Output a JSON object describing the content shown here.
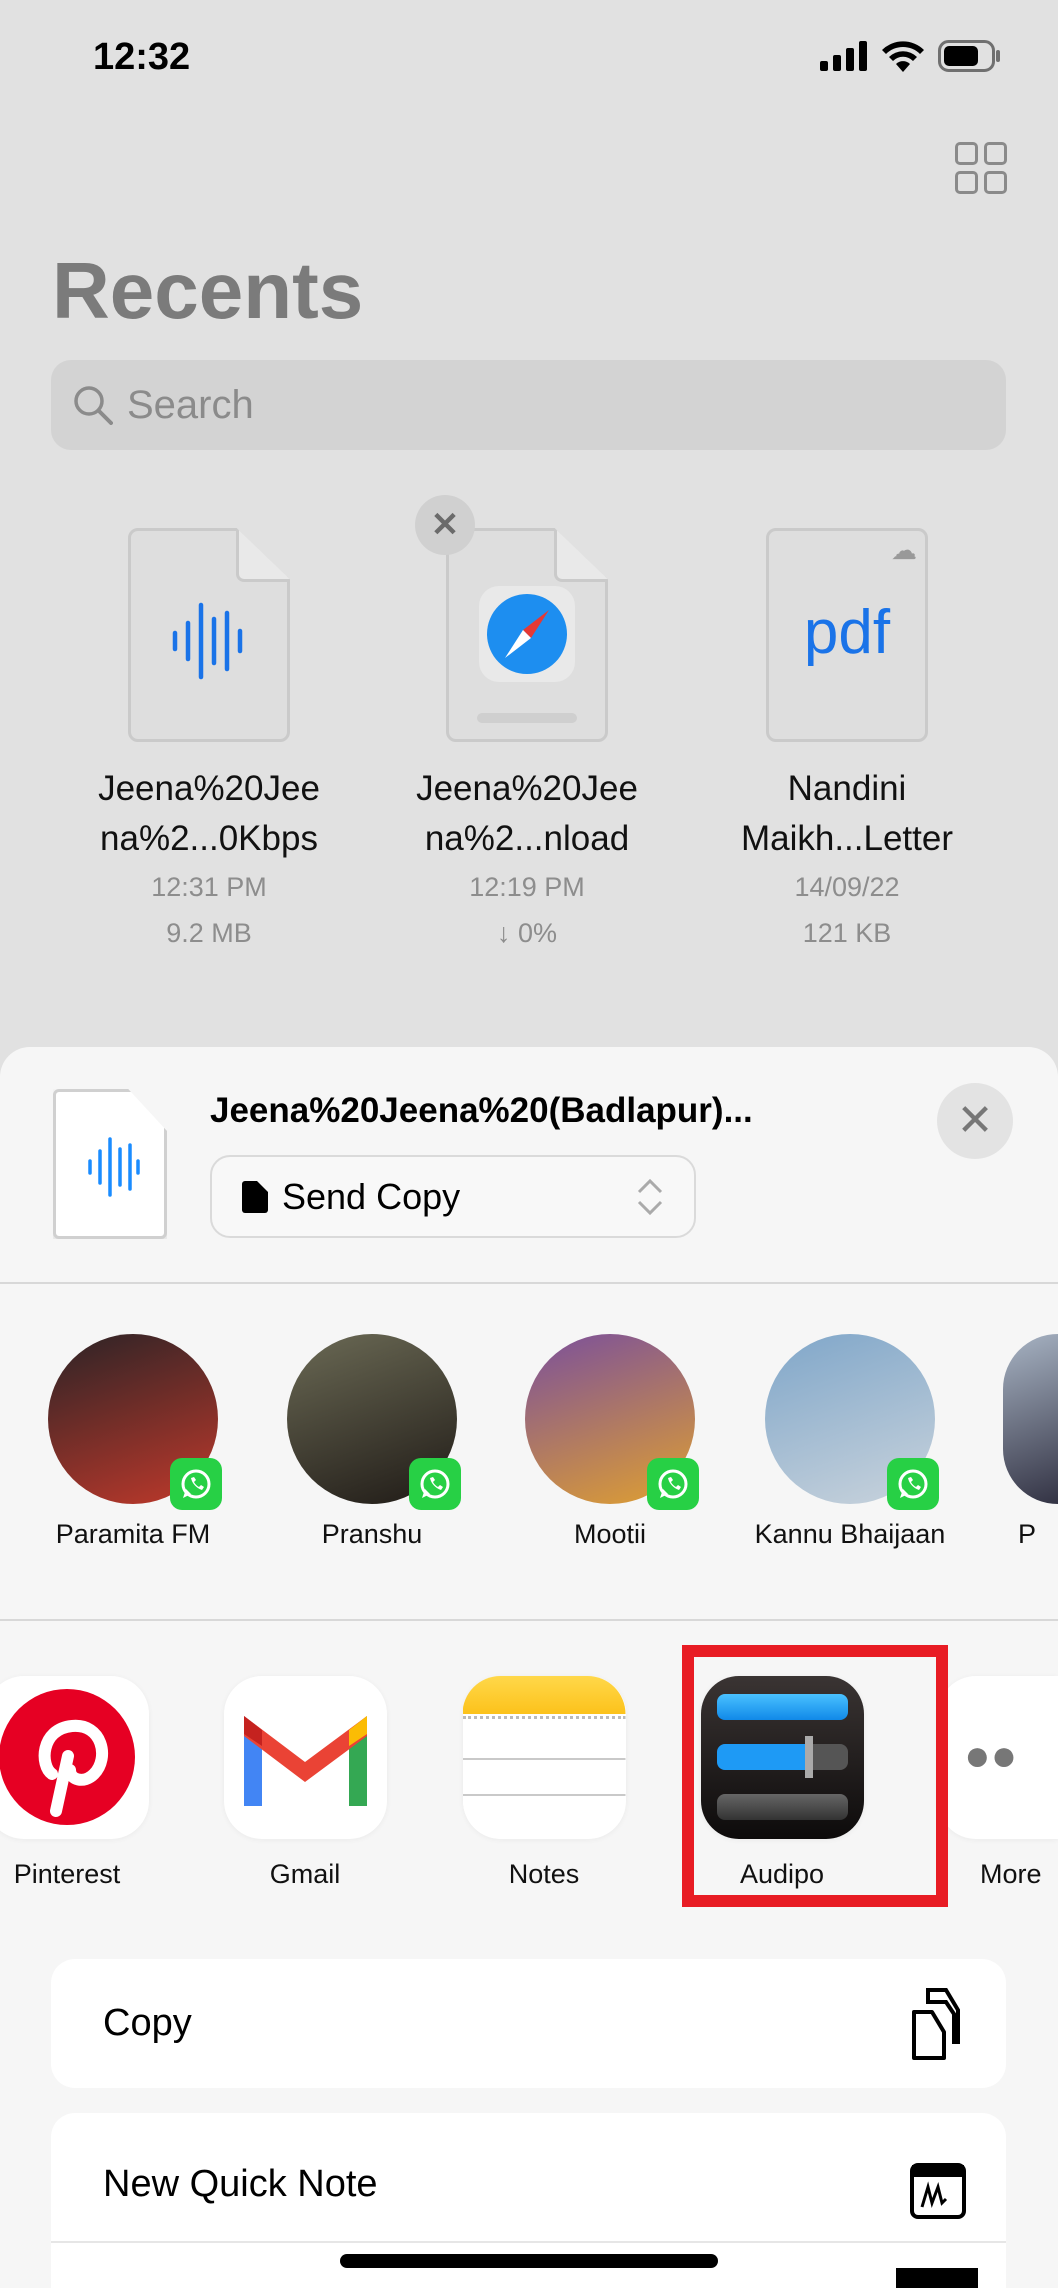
{
  "status_bar": {
    "time": "12:32",
    "icons": [
      "cellular-signal-icon",
      "wifi-icon",
      "battery-icon"
    ]
  },
  "header": {
    "title": "Recents",
    "grid_icon": "grid-view-icon"
  },
  "search": {
    "placeholder": "Search"
  },
  "files": [
    {
      "name1": "Jeena%20Jee",
      "name2": "na%2...0Kbps",
      "meta1": "12:31 PM",
      "meta2": "9.2 MB",
      "icon": "audio-waveform-icon"
    },
    {
      "name1": "Jeena%20Jee",
      "name2": "na%2...nload",
      "meta1": "12:19 PM",
      "meta2": "↓ 0%",
      "icon": "safari-icon"
    },
    {
      "name1": "Nandini",
      "name2": "Maikh...Letter",
      "meta1": "14/09/22",
      "meta2": "121 KB",
      "icon": "pdf-icon",
      "glyph": "pdf"
    }
  ],
  "share": {
    "title": "Jeena%20Jeena%20(Badlapur)...",
    "mode": "Send Copy",
    "people": [
      {
        "name": "Paramita FM",
        "colors": [
          "#2b2326",
          "#c0392b"
        ]
      },
      {
        "name": "Pranshu",
        "colors": [
          "#6b6a55",
          "#1f1a16"
        ]
      },
      {
        "name": "Mootii",
        "colors": [
          "#7a4f9c",
          "#e0a030"
        ]
      },
      {
        "name": "Kannu Bhaijaan",
        "colors": [
          "#7fa6c9",
          "#c9d3dc"
        ]
      },
      {
        "name": "P",
        "colors": [
          "#a8b4c4",
          "#334"
        ]
      }
    ],
    "apps": [
      {
        "name": "Pinterest"
      },
      {
        "name": "Gmail"
      },
      {
        "name": "Notes"
      },
      {
        "name": "Audipo"
      },
      {
        "name": "More"
      }
    ],
    "actions": [
      {
        "label": "Copy",
        "icon": "copy-icon"
      },
      {
        "label": "New Quick Note",
        "icon": "quick-note-icon"
      }
    ],
    "highlight_color": "#e81c24",
    "whatsapp_color": "#27d045"
  }
}
